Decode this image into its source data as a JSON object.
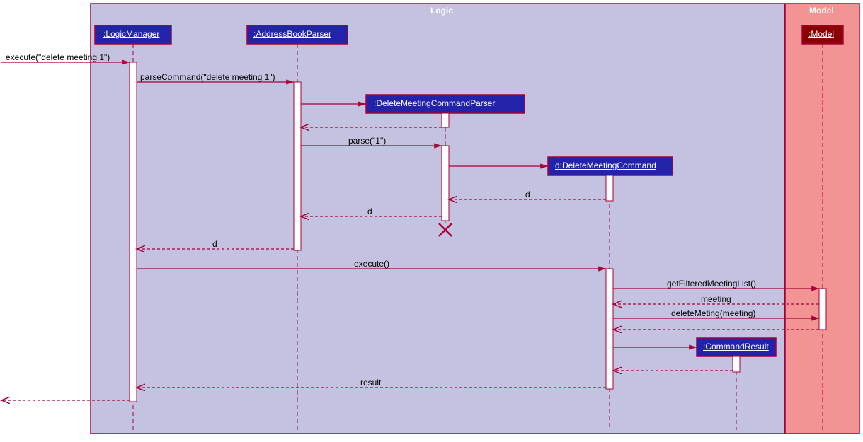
{
  "frames": {
    "logic": {
      "title": "Logic"
    },
    "model": {
      "title": "Model"
    }
  },
  "participants": {
    "logicManager": {
      "label": ":LogicManager"
    },
    "addressBookParser": {
      "label": ":AddressBookParser"
    },
    "deleteParser": {
      "label": ":DeleteMeetingCommandParser"
    },
    "deleteCommand": {
      "label": "d:DeleteMeetingCommand"
    },
    "commandResult": {
      "label": ":CommandResult"
    },
    "model": {
      "label": ":Model"
    }
  },
  "messages": {
    "msg1": "execute(\"delete meeting 1\")",
    "msg2": "parseCommand(\"delete meeting 1\")",
    "msg3": "parse(\"1\")",
    "ret_d1": "d",
    "ret_d2": "d",
    "ret_d3": "d",
    "execute": "execute()",
    "getFiltered": "getFilteredMeetingList()",
    "ret_meeting": "meeting",
    "deleteMeeting": "deleteMeting(meeting)",
    "ret_result": "result"
  }
}
